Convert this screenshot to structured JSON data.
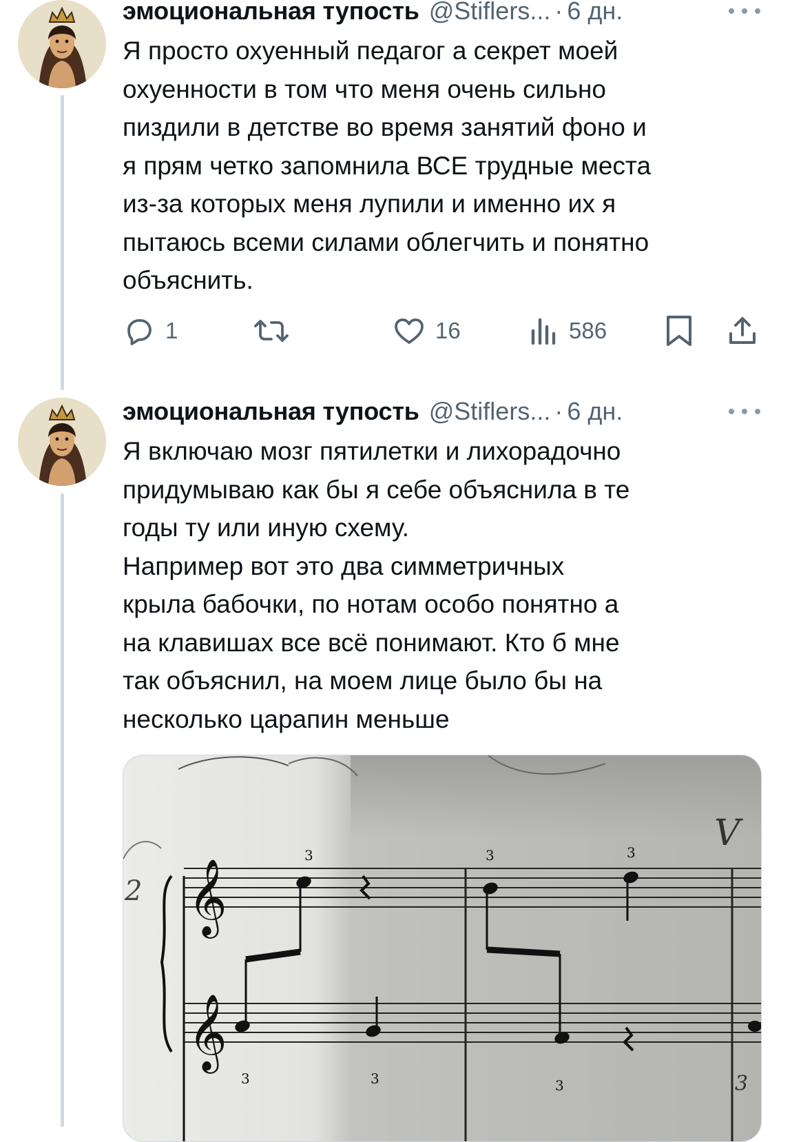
{
  "tweets": [
    {
      "author": "эмоциональная тупость",
      "handle": "@Stiflers...",
      "separator": "·",
      "time": "6 дн.",
      "text": "Я просто охуенный педагог а секрет моей\nохуенности в том что меня очень сильно\nпиздили в детстве во время занятий фоно и\nя прям четко запомнила ВСЕ трудные места\nиз-за которых меня лупили и именно их я\nпытаюсь всеми силами облегчить и понятно\nобъяснить.",
      "actions": {
        "replies": "1",
        "retweets": "",
        "likes": "16",
        "views": "586"
      }
    },
    {
      "author": "эмоциональная тупость",
      "handle": "@Stiflers...",
      "separator": "·",
      "time": "6 дн.",
      "text": "Я включаю мозг пятилетки и лихорадочно\nпридумываю как бы я себе объяснила в те\nгоды ту или иную схему.\nНапример вот это два симметричных\nкрыла бабочки, по нотам особо понятно а\nна клавишах все всё понимают. Кто б мне\nтак объяснил, на моем лице было бы на\nнесколько царапин меньше"
    }
  ],
  "media": {
    "fingerings": [
      "3",
      "3",
      "3",
      "3",
      "3",
      "3",
      "3"
    ],
    "handwriting_mark": "V",
    "measure_number": "2"
  },
  "colors": {
    "text": "#0f1419",
    "secondary": "#536471",
    "thread_line": "#cfd9de"
  },
  "icons": [
    "reply-icon",
    "retweet-icon",
    "like-icon",
    "views-icon",
    "bookmark-icon",
    "share-icon",
    "more-icon",
    "avatar"
  ]
}
